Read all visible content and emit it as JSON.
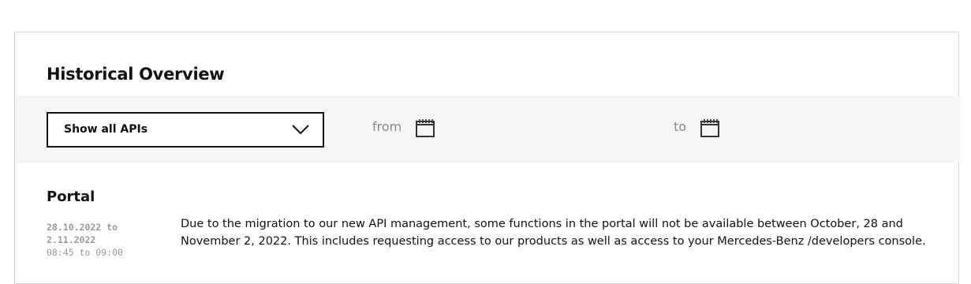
{
  "overview": {
    "title": "Historical Overview"
  },
  "filters": {
    "api_select": {
      "selected": "Show all APIs"
    },
    "from_label": "from",
    "to_label": "to",
    "icons": {
      "chevron": "chevron-down-icon",
      "calendar": "calendar-icon"
    }
  },
  "entries": [
    {
      "section": "Portal",
      "start": "28.10.2022 to",
      "end": "2.11.2022",
      "time": "08:45 to 09:00",
      "message": "Due to the migration to our new API management, some functions in the portal will not be available between October, 28 and November 2, 2022. This includes requesting access to our products as well as access to your Mercedes-Benz /developers console."
    }
  ],
  "colors": {
    "border": "#d6d6d6",
    "filter_bg": "#f6f6f6",
    "muted_text": "#8a8a8a",
    "text": "#111111"
  }
}
